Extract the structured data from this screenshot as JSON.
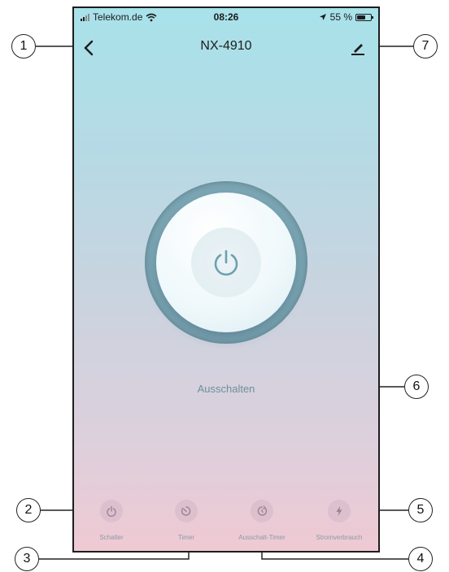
{
  "status_bar": {
    "carrier": "Telekom.de",
    "time": "08:26",
    "battery": "55 %"
  },
  "header": {
    "title": "NX-4910"
  },
  "main": {
    "power_status": "Ausschalten"
  },
  "tabs": [
    {
      "label": "Schalter",
      "icon": "power-icon"
    },
    {
      "label": "Timer",
      "icon": "timer-icon"
    },
    {
      "label": "Ausschalt-Timer",
      "icon": "off-timer-icon"
    },
    {
      "label": "Stromverbrauch",
      "icon": "lightning-icon"
    }
  ],
  "callouts": [
    "1",
    "2",
    "3",
    "4",
    "5",
    "6",
    "7"
  ],
  "colors": {
    "accent": "#6f9fb0",
    "tab_icon": "#9a8394"
  }
}
